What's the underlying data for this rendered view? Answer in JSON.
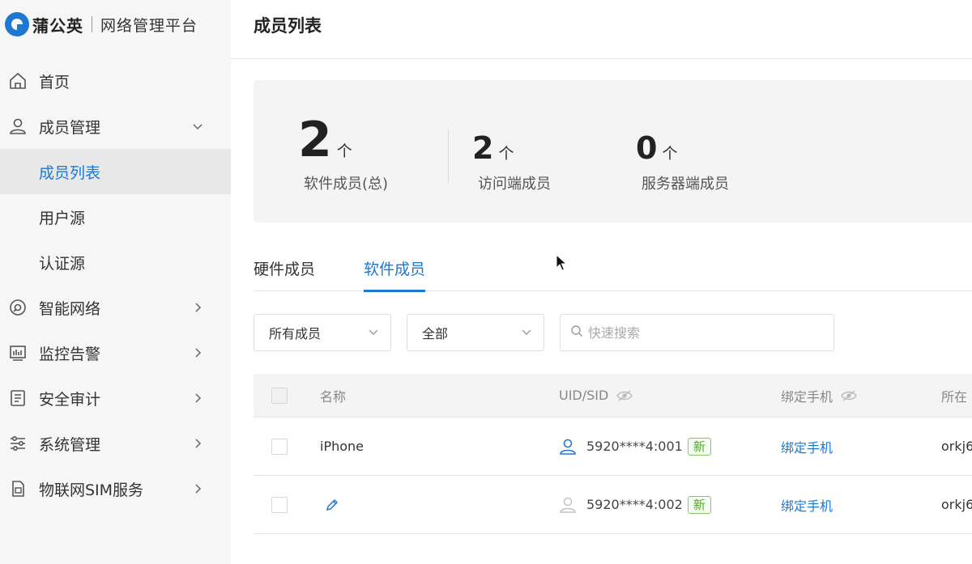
{
  "app": {
    "brand": "蒲公英",
    "subtitle": "网络管理平台",
    "brand_color": "#1e78d2"
  },
  "sidebar": {
    "items": [
      {
        "label": "首页",
        "icon": "home-icon",
        "expandable": false
      },
      {
        "label": "成员管理",
        "icon": "user-icon",
        "expandable": true,
        "expanded": true,
        "children": [
          {
            "label": "成员列表",
            "active": true
          },
          {
            "label": "用户源",
            "active": false
          },
          {
            "label": "认证源",
            "active": false
          }
        ]
      },
      {
        "label": "智能网络",
        "icon": "network-icon",
        "expandable": true
      },
      {
        "label": "监控告警",
        "icon": "monitor-icon",
        "expandable": true
      },
      {
        "label": "安全审计",
        "icon": "audit-icon",
        "expandable": true
      },
      {
        "label": "系统管理",
        "icon": "settings-sliders-icon",
        "expandable": true
      },
      {
        "label": "物联网SIM服务",
        "icon": "sim-card-icon",
        "expandable": true
      }
    ]
  },
  "page": {
    "title": "成员列表"
  },
  "stats": [
    {
      "value": "2",
      "unit": "个",
      "caption": "软件成员(总)"
    },
    {
      "value": "2",
      "unit": "个",
      "caption": "访问端成员"
    },
    {
      "value": "0",
      "unit": "个",
      "caption": "服务器端成员"
    }
  ],
  "tabs": [
    {
      "label": "硬件成员",
      "active": false
    },
    {
      "label": "软件成员",
      "active": true
    }
  ],
  "filters": {
    "member_select": "所有成员",
    "type_select": "全部",
    "search_placeholder": "快速搜索"
  },
  "table": {
    "columns": {
      "name": "名称",
      "uid": "UID/SID",
      "phone": "绑定手机",
      "location": "所在"
    },
    "rows": [
      {
        "name": "iPhone",
        "uid": "5920****4:001",
        "badge": "新",
        "phone": "绑定手机",
        "location": "orkj6",
        "online": true
      },
      {
        "name": "",
        "uid": "5920****4:002",
        "badge": "新",
        "phone": "绑定手机",
        "location": "orkj6",
        "online": false
      }
    ]
  }
}
